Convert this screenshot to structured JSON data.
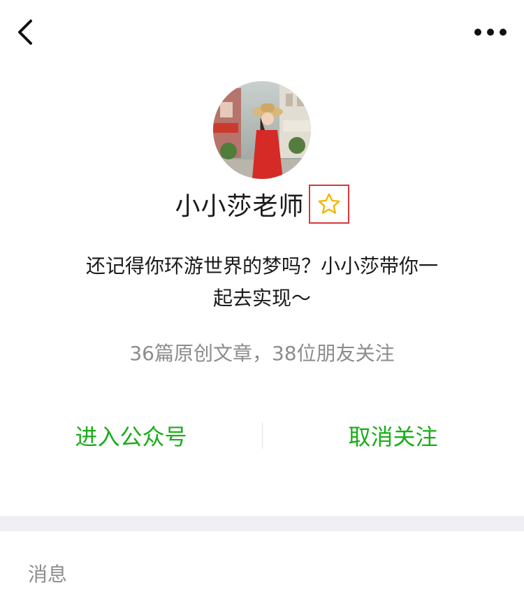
{
  "profile": {
    "name": "小小莎老师",
    "description_line1": "还记得你环游世界的梦吗？小小莎带你一",
    "description_line2": "起去实现～",
    "stats": "36篇原创文章，38位朋友关注",
    "star_icon": "star-outline-icon"
  },
  "actions": {
    "enter_label": "进入公众号",
    "unfollow_label": "取消关注"
  },
  "sections": {
    "messages_label": "消息"
  },
  "icons": {
    "back": "chevron-left-icon",
    "more": "more-dots-icon"
  },
  "colors": {
    "accent_green": "#1aad19",
    "highlight_red": "#d8383a",
    "star_gold": "#f2b705"
  }
}
